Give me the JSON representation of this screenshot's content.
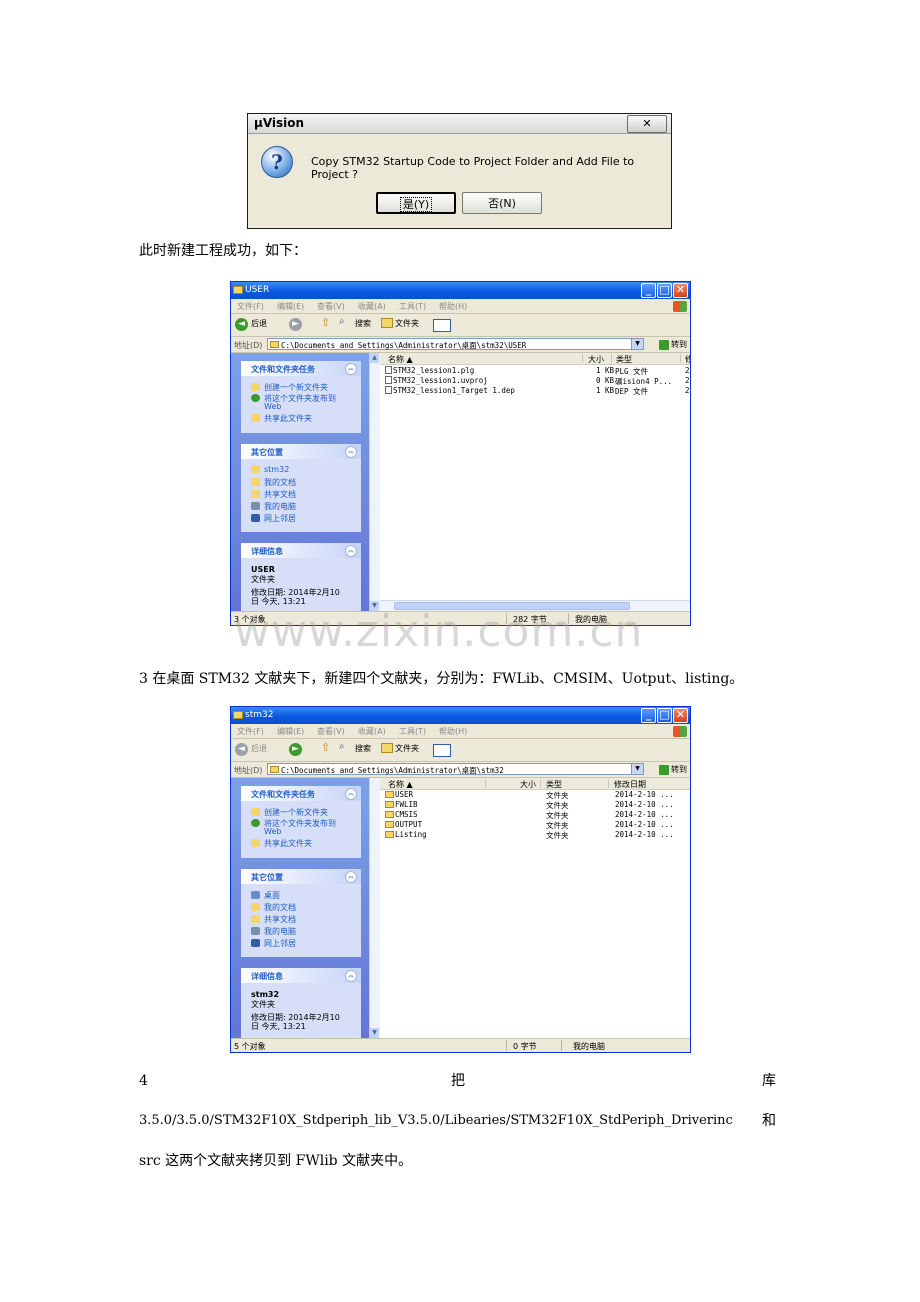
{
  "dialog": {
    "title": "μVision",
    "close_label": "✕",
    "message": "Copy STM32 Startup Code to Project Folder and Add File to Project ?",
    "yes_label": "是(Y)",
    "no_label": "否(N)"
  },
  "para1": "此时新建工程成功，如下：",
  "explorer1": {
    "title": "USER",
    "menu": [
      "文件(F)",
      "编辑(E)",
      "查看(V)",
      "收藏(A)",
      "工具(T)",
      "帮助(H)"
    ],
    "toolbar": {
      "back": "后退",
      "search": "搜索",
      "folders": "文件夹"
    },
    "address_label": "地址(D)",
    "address": "C:\\Documents and Settings\\Administrator\\桌面\\stm32\\USER",
    "go_label": "转到",
    "tasks_title": "文件和文件夹任务",
    "tasks": [
      "创建一个新文件夹",
      "将这个文件夹发布到",
      "Web",
      "共享此文件夹"
    ],
    "places_title": "其它位置",
    "places": [
      "stm32",
      "我的文档",
      "共享文档",
      "我的电脑",
      "网上邻居"
    ],
    "details_title": "详细信息",
    "details_name": "USER",
    "details_type": "文件夹",
    "details_date1": "修改日期: 2014年2月10",
    "details_date2": "日 今天, 13:21",
    "columns": {
      "name": "名称 ▲",
      "size": "大小",
      "type": "类型",
      "date": "修"
    },
    "files": [
      {
        "name": "STM32_lession1.plg",
        "size": "1 KB",
        "type": "PLG 文件",
        "date": "20"
      },
      {
        "name": "STM32_lession1.uvproj",
        "size": "0 KB",
        "type": "礦ision4 P...",
        "date": "20"
      },
      {
        "name": "STM32_lession1_Target 1.dep",
        "size": "1 KB",
        "type": "DEP 文件",
        "date": "20"
      }
    ],
    "status_count": "3 个对象",
    "status_size": "282 字节",
    "status_location": "我的电脑"
  },
  "watermark": "www.zixin.com.cn",
  "para2": "3  在桌面 STM32 文献夹下，新建四个文献夹，分别为：FWLib、CMSIM、Uotput、listing。",
  "explorer2": {
    "title": "stm32",
    "menu": [
      "文件(F)",
      "编辑(E)",
      "查看(V)",
      "收藏(A)",
      "工具(T)",
      "帮助(H)"
    ],
    "toolbar": {
      "back": "后退",
      "search": "搜索",
      "folders": "文件夹"
    },
    "address_label": "地址(D)",
    "address": "C:\\Documents and Settings\\Administrator\\桌面\\stm32",
    "go_label": "转到",
    "tasks_title": "文件和文件夹任务",
    "tasks": [
      "创建一个新文件夹",
      "将这个文件夹发布到",
      "Web",
      "共享此文件夹"
    ],
    "places_title": "其它位置",
    "places": [
      "桌面",
      "我的文档",
      "共享文档",
      "我的电脑",
      "网上邻居"
    ],
    "details_title": "详细信息",
    "details_name": "stm32",
    "details_type": "文件夹",
    "details_date1": "修改日期: 2014年2月10",
    "details_date2": "日 今天, 13:21",
    "columns": {
      "name": "名称 ▲",
      "size": "大小",
      "type": "类型",
      "date": "修改日期"
    },
    "files": [
      {
        "name": "USER",
        "type": "文件夹",
        "date": "2014-2-10 ..."
      },
      {
        "name": "FWLIB",
        "type": "文件夹",
        "date": "2014-2-10 ..."
      },
      {
        "name": "CMSIS",
        "type": "文件夹",
        "date": "2014-2-10 ..."
      },
      {
        "name": "OUTPUT",
        "type": "文件夹",
        "date": "2014-2-10 ..."
      },
      {
        "name": "Listing",
        "type": "文件夹",
        "date": "2014-2-10 ..."
      }
    ],
    "status_count": "5 个对象",
    "status_size": "0 字节",
    "status_location": "我的电脑"
  },
  "para3": {
    "num": "4",
    "verb": "把",
    "word": "库"
  },
  "para4": {
    "path": "3.5.0/3.5.0/STM32F10X_Stdperiph_lib_V3.5.0/Libearies/STM32F10X_StdPeriph_Driverinc",
    "and": "和"
  },
  "para5": "src 这两个文献夹拷贝到 FWlib 文献夹中。"
}
